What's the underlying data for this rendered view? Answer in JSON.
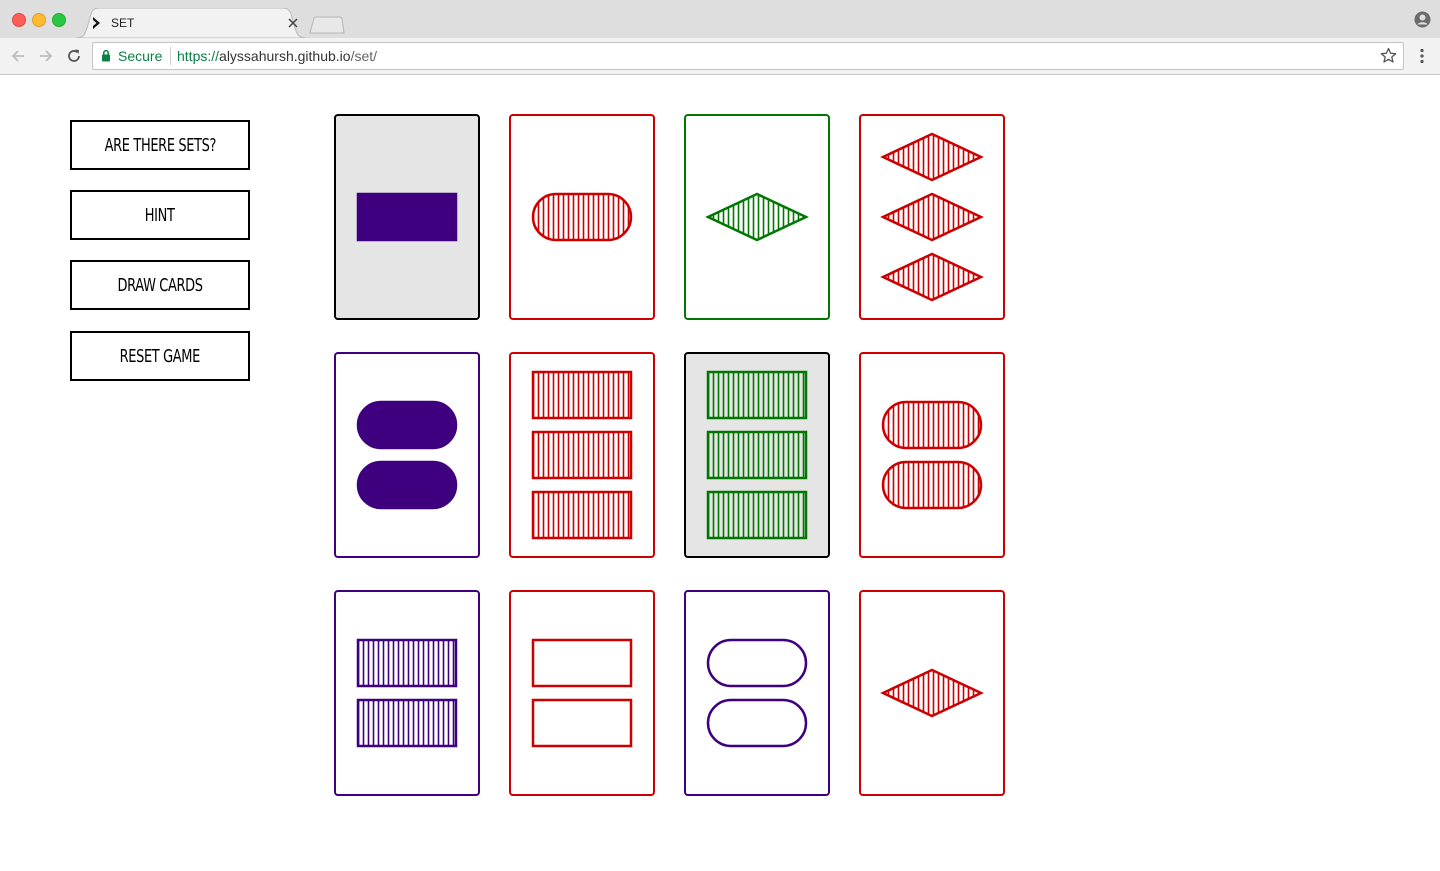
{
  "browser": {
    "tab_title": "SET",
    "secure_label": "Secure",
    "url_scheme": "https://",
    "url_host": "alyssahursh.github.io",
    "url_path": "/set/"
  },
  "sidebar": {
    "buttons": [
      {
        "label": "ARE THERE SETS?"
      },
      {
        "label": "HINT"
      },
      {
        "label": "DRAW CARDS"
      },
      {
        "label": "RESET GAME"
      }
    ]
  },
  "colors": {
    "purple": "#3f007f",
    "red": "#cc0000",
    "green": "#007700",
    "selected_bg": "#e5e5e5"
  },
  "cards": [
    {
      "color": "purple",
      "shape": "rectangle",
      "fill": "solid",
      "count": 1,
      "selected": true
    },
    {
      "color": "red",
      "shape": "oval",
      "fill": "striped",
      "count": 1,
      "selected": false
    },
    {
      "color": "green",
      "shape": "diamond",
      "fill": "striped",
      "count": 1,
      "selected": false
    },
    {
      "color": "red",
      "shape": "diamond",
      "fill": "striped",
      "count": 3,
      "selected": false
    },
    {
      "color": "purple",
      "shape": "oval",
      "fill": "solid",
      "count": 2,
      "selected": false
    },
    {
      "color": "red",
      "shape": "rectangle",
      "fill": "striped",
      "count": 3,
      "selected": false
    },
    {
      "color": "green",
      "shape": "rectangle",
      "fill": "striped",
      "count": 3,
      "selected": true
    },
    {
      "color": "red",
      "shape": "oval",
      "fill": "striped",
      "count": 2,
      "selected": false
    },
    {
      "color": "purple",
      "shape": "rectangle",
      "fill": "striped",
      "count": 2,
      "selected": false
    },
    {
      "color": "red",
      "shape": "rectangle",
      "fill": "empty",
      "count": 2,
      "selected": false
    },
    {
      "color": "purple",
      "shape": "oval",
      "fill": "empty",
      "count": 2,
      "selected": false
    },
    {
      "color": "red",
      "shape": "diamond",
      "fill": "striped",
      "count": 1,
      "selected": false
    }
  ]
}
